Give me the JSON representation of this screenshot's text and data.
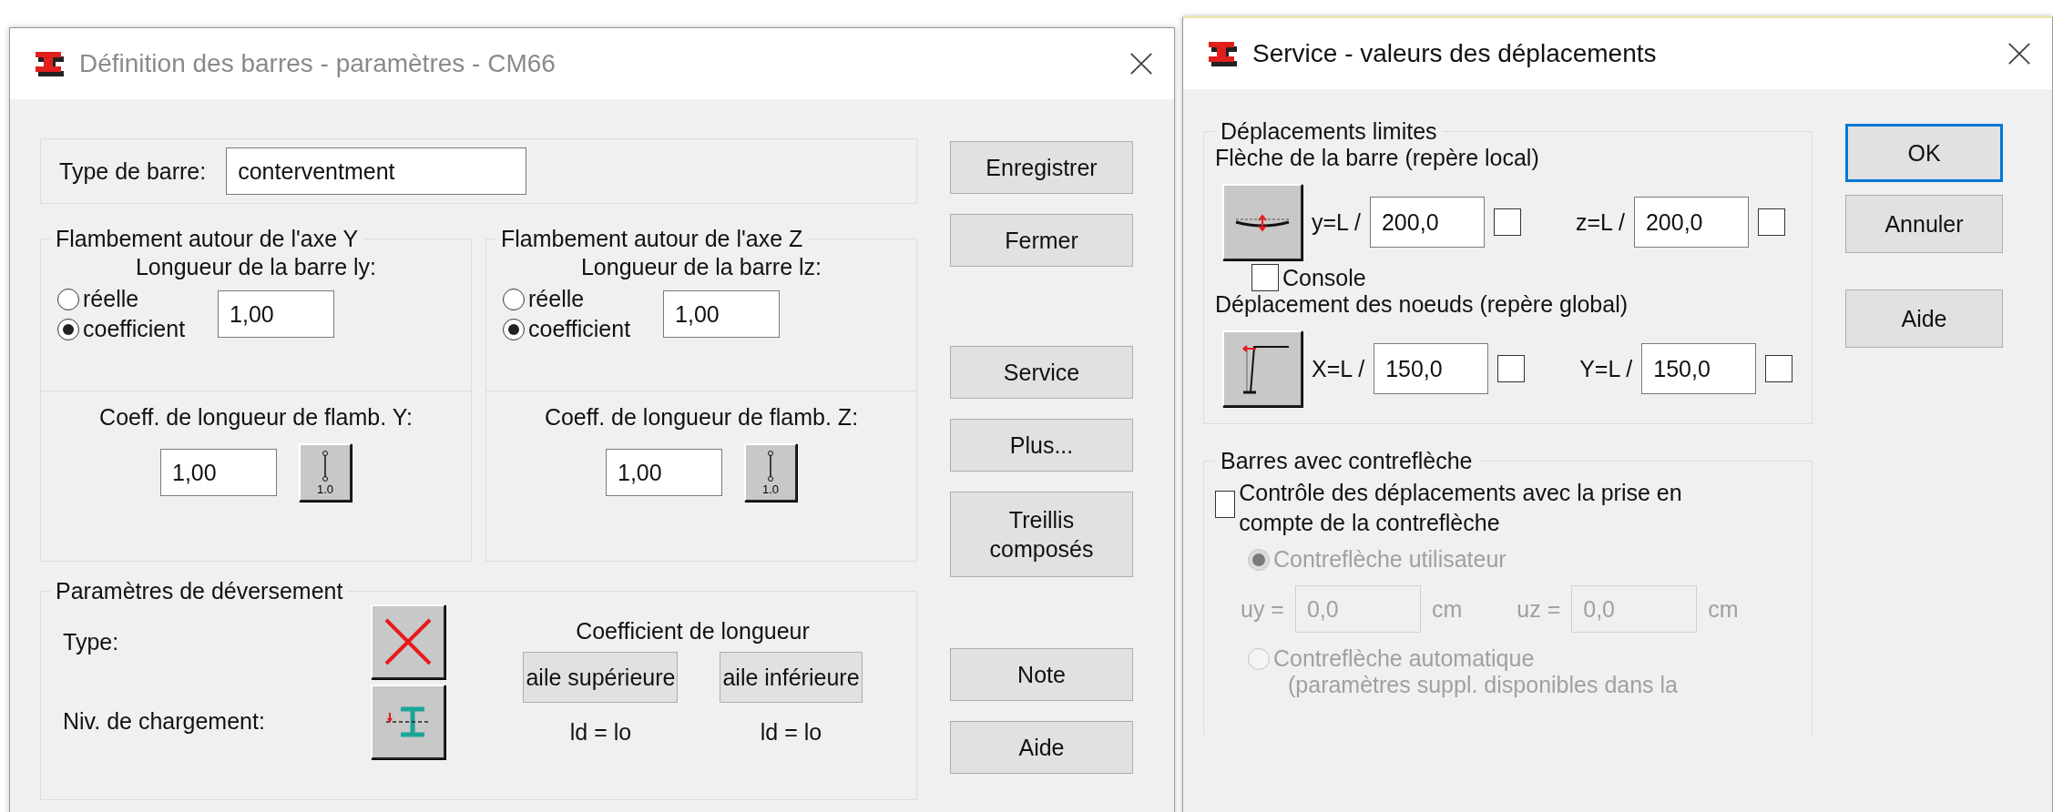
{
  "left_dialog": {
    "title": "Définition des barres - paramètres - CM66",
    "bar_type": {
      "label": "Type de barre:",
      "value": "conterventment"
    },
    "buckling": [
      {
        "legend": "Flambement autour de l'axe Y",
        "length_label": "Longueur de la barre ly:",
        "options": [
          {
            "label": "réelle",
            "selected": false
          },
          {
            "label": "coefficient",
            "selected": true
          }
        ],
        "value": "1,00",
        "coeff_label": "Coeff. de longueur de flamb. Y:",
        "coeff_value": "1,00",
        "coeff_button": "1.0"
      },
      {
        "legend": "Flambement autour de l'axe Z",
        "length_label": "Longueur de la barre lz:",
        "options": [
          {
            "label": "réelle",
            "selected": false
          },
          {
            "label": "coefficient",
            "selected": true
          }
        ],
        "value": "1,00",
        "coeff_label": "Coeff. de longueur de flamb. Z:",
        "coeff_value": "1,00",
        "coeff_button": "1.0"
      }
    ],
    "lateral": {
      "legend": "Paramètres de déversement",
      "type_label": "Type:",
      "load_label": "Niv. de chargement:",
      "coeff_title": "Coefficient de longueur",
      "flanges": [
        {
          "button": "aile supérieure",
          "value": "ld = lo"
        },
        {
          "button": "aile inférieure",
          "value": "ld = lo"
        }
      ]
    },
    "buttons": [
      "Enregistrer",
      "Fermer",
      "Service",
      "Plus...",
      "Treillis composés",
      "Note",
      "Aide"
    ]
  },
  "right_dialog": {
    "title": "Service - valeurs des déplacements",
    "limits": {
      "legend": "Déplacements limites",
      "rows": [
        {
          "kind": "beam",
          "label": "Flèche de la barre (repère local)",
          "fields": [
            {
              "label": "y=L /",
              "value": "200,0",
              "checked": false
            },
            {
              "label": "z=L /",
              "value": "200,0",
              "checked": false
            }
          ]
        },
        {
          "kind": "frame",
          "label": "Déplacement des noeuds (repère global)",
          "fields": [
            {
              "label": "X=L /",
              "value": "150,0",
              "checked": false
            },
            {
              "label": "Y=L /",
              "value": "150,0",
              "checked": false
            }
          ]
        }
      ],
      "console": {
        "label": "Console",
        "checked": false
      }
    },
    "camber": {
      "legend": "Barres avec contreflèche",
      "check": {
        "label": "Contrôle des déplacements avec la prise en compte de la contreflèche",
        "checked": false
      },
      "options": [
        {
          "label": "Contreflèche utilisateur",
          "selected": true,
          "disabled": true
        },
        {
          "label": "Contreflèche automatique",
          "selected": false,
          "disabled": true,
          "note": "(paramètres suppl. disponibles dans la"
        }
      ],
      "fields": [
        {
          "label": "uy =",
          "value": "0,0",
          "unit": "cm",
          "disabled": true
        },
        {
          "label": "uz =",
          "value": "0,0",
          "unit": "cm",
          "disabled": true
        }
      ]
    },
    "buttons": [
      {
        "label": "OK",
        "default": true
      },
      {
        "label": "Annuler",
        "default": false
      },
      {
        "label": "Aide",
        "default": false
      }
    ]
  }
}
